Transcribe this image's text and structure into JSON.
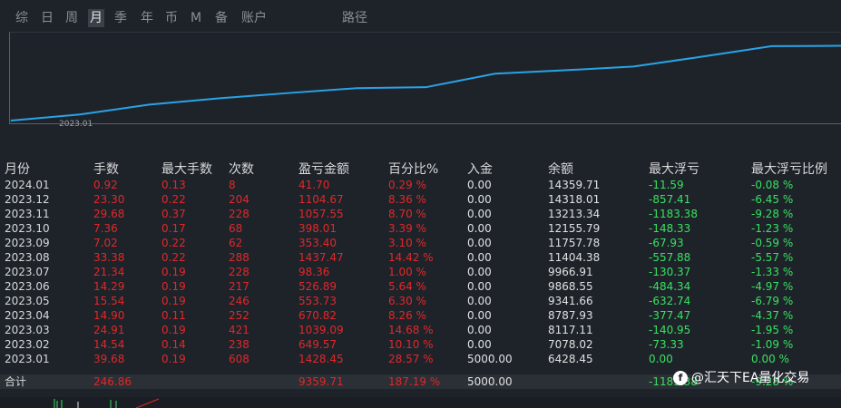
{
  "tabs": [
    {
      "label": "综",
      "active": false
    },
    {
      "label": "日",
      "active": false
    },
    {
      "label": "周",
      "active": false
    },
    {
      "label": "月",
      "active": true
    },
    {
      "label": "季",
      "active": false
    },
    {
      "label": "年",
      "active": false
    },
    {
      "label": "币",
      "active": false
    },
    {
      "label": "M",
      "active": false
    },
    {
      "label": "备",
      "active": false
    },
    {
      "label": "账户",
      "active": false
    },
    {
      "label": "路径",
      "active": false
    }
  ],
  "chart_data": {
    "type": "line",
    "x_tick_label": "2023.01",
    "x": [
      "2023.01",
      "2023.02",
      "2023.03",
      "2023.04",
      "2023.05",
      "2023.06",
      "2023.07",
      "2023.08",
      "2023.09",
      "2023.10",
      "2023.11",
      "2023.12",
      "2024.01"
    ],
    "series": [
      {
        "values": [
          6428.45,
          7078.02,
          8117.11,
          8787.93,
          9341.66,
          9868.55,
          9966.91,
          11404.38,
          11757.78,
          12155.79,
          13213.34,
          14318.01,
          14359.71
        ]
      }
    ],
    "line_color": "#29a3e6"
  },
  "table": {
    "headers": [
      "月份",
      "手数",
      "最大手数",
      "次数",
      "盈亏金额",
      "百分比%",
      "入金",
      "余额",
      "最大浮亏",
      "最大浮亏比例"
    ],
    "rows": [
      [
        "2024.01",
        "0.92",
        "0.13",
        "8",
        "41.70",
        "0.29 %",
        "0.00",
        "14359.71",
        "-11.59",
        "-0.08 %"
      ],
      [
        "2023.12",
        "23.30",
        "0.22",
        "204",
        "1104.67",
        "8.36 %",
        "0.00",
        "14318.01",
        "-857.41",
        "-6.45 %"
      ],
      [
        "2023.11",
        "29.68",
        "0.37",
        "228",
        "1057.55",
        "8.70 %",
        "0.00",
        "13213.34",
        "-1183.38",
        "-9.28 %"
      ],
      [
        "2023.10",
        "7.36",
        "0.17",
        "68",
        "398.01",
        "3.39 %",
        "0.00",
        "12155.79",
        "-148.33",
        "-1.23 %"
      ],
      [
        "2023.09",
        "7.02",
        "0.22",
        "62",
        "353.40",
        "3.10 %",
        "0.00",
        "11757.78",
        "-67.93",
        "-0.59 %"
      ],
      [
        "2023.08",
        "33.38",
        "0.22",
        "288",
        "1437.47",
        "14.42 %",
        "0.00",
        "11404.38",
        "-557.88",
        "-5.57 %"
      ],
      [
        "2023.07",
        "21.34",
        "0.19",
        "228",
        "98.36",
        "1.00 %",
        "0.00",
        "9966.91",
        "-130.37",
        "-1.33 %"
      ],
      [
        "2023.06",
        "14.29",
        "0.19",
        "217",
        "526.89",
        "5.64 %",
        "0.00",
        "9868.55",
        "-484.34",
        "-4.97 %"
      ],
      [
        "2023.05",
        "15.54",
        "0.19",
        "246",
        "553.73",
        "6.30 %",
        "0.00",
        "9341.66",
        "-632.74",
        "-6.79 %"
      ],
      [
        "2023.04",
        "14.90",
        "0.11",
        "252",
        "670.82",
        "8.26 %",
        "0.00",
        "8787.93",
        "-377.47",
        "-4.37 %"
      ],
      [
        "2023.03",
        "24.91",
        "0.19",
        "421",
        "1039.09",
        "14.68 %",
        "0.00",
        "8117.11",
        "-140.95",
        "-1.95 %"
      ],
      [
        "2023.02",
        "14.54",
        "0.14",
        "238",
        "649.57",
        "10.10 %",
        "0.00",
        "7078.02",
        "-73.33",
        "-1.09 %"
      ],
      [
        "2023.01",
        "39.68",
        "0.19",
        "608",
        "1428.45",
        "28.57 %",
        "5000.00",
        "6428.45",
        "0.00",
        "0.00 %"
      ]
    ],
    "total": [
      "合计",
      "246.86",
      "",
      "",
      "9359.71",
      "187.19 %",
      "5000.00",
      "",
      "-1183.38",
      "-9.28 %"
    ]
  },
  "watermark": {
    "badge": "f",
    "text": "@汇天下EA量化交易"
  },
  "colors": {
    "background": "#1e232a",
    "positive": "#e02828",
    "negative": "#38e060"
  }
}
